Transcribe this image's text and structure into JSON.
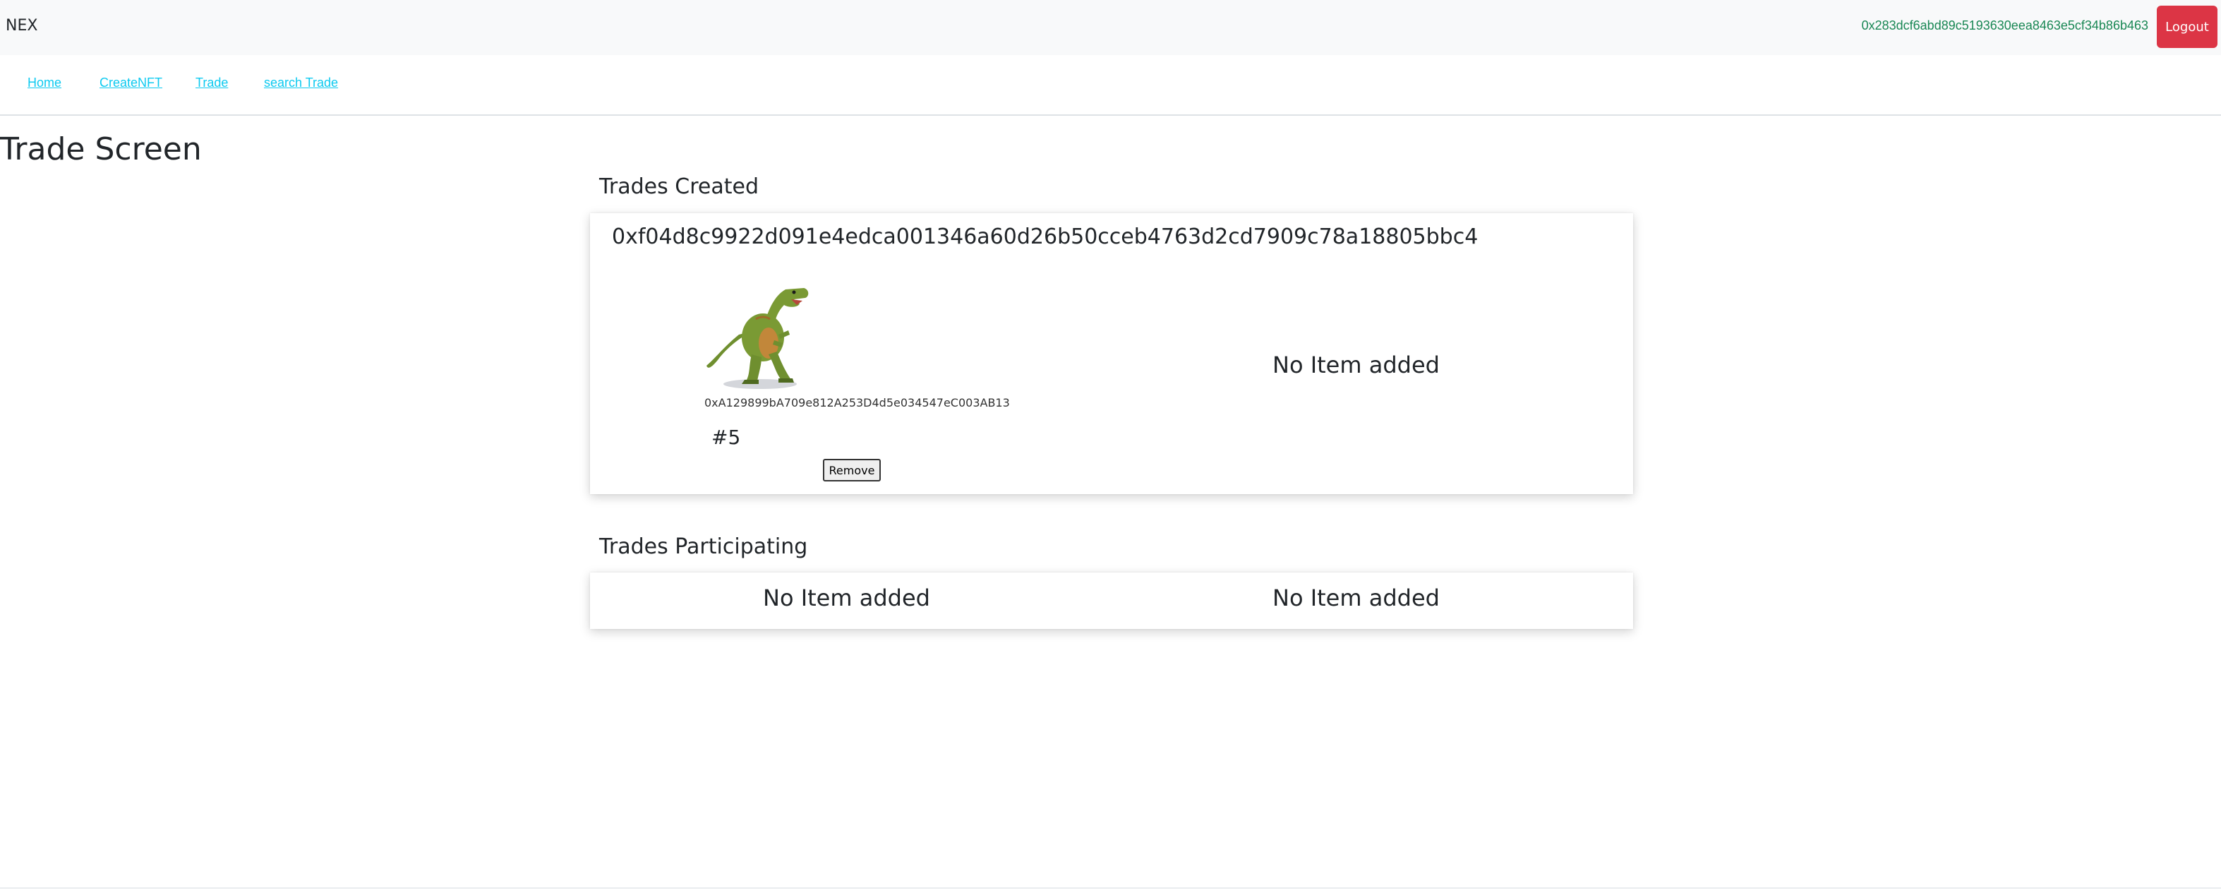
{
  "header": {
    "brand": "NEX",
    "account_address": "0x283dcf6abd89c5193630eea8463e5cf34b86b463",
    "logout_label": "Logout"
  },
  "nav": {
    "home": "Home",
    "create_nft": "CreateNFT",
    "trade": "Trade",
    "search_trade": "search Trade"
  },
  "page": {
    "title": "Trade Screen"
  },
  "trades_created": {
    "heading": "Trades Created",
    "trade": {
      "id": "0xf04d8c9922d091e4edca001346a60d26b50cceb4763d2cd7909c78a18805bbc4",
      "offered_item": {
        "contract_address": "0xA129899bA709e812A253D4d5e034547eC003AB13",
        "token_id": "#5",
        "remove_label": "Remove"
      },
      "requested_empty_label": "No Item added"
    }
  },
  "trades_participating": {
    "heading": "Trades Participating",
    "left_empty_label": "No Item added",
    "right_empty_label": "No Item added"
  },
  "colors": {
    "account_text": "#198754",
    "logout_bg": "#dc3545",
    "nav_link": "#0dcaf0",
    "topbar_bg": "#f8f9fa"
  }
}
